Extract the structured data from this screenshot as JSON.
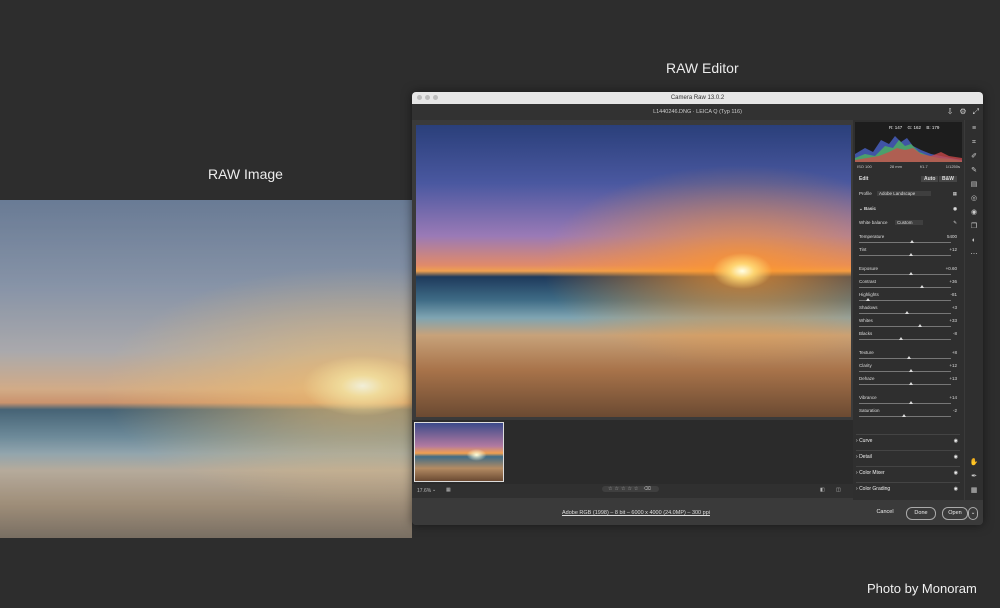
{
  "labels": {
    "raw_image": "RAW Image",
    "raw_editor": "RAW Editor",
    "credit": "Photo by Monoram"
  },
  "window": {
    "title": "Camera Raw 13.0.2",
    "file_info": "L1440246.DNG  ·  LEICA Q (Typ 116)",
    "zoom": "17.6%",
    "meta": "Adobe RGB (1998) – 8 bit – 6000 x 4000 (24.0MP) – 300 ppi",
    "buttons": {
      "cancel": "Cancel",
      "done": "Done",
      "open": "Open"
    }
  },
  "histogram": {
    "r": "R: 147",
    "g": "G: 162",
    "b": "B: 179"
  },
  "camera": {
    "iso": "ISO 100",
    "focal": "28 mm",
    "aperture": "f/1.7",
    "shutter": "1/1250s"
  },
  "panel": {
    "edit": "Edit",
    "auto": "Auto",
    "bw": "B&W",
    "profile_label": "Profile",
    "profile_value": "Adobe Landscape",
    "basic": "Basic",
    "wb_label": "White balance",
    "wb_value": "Custom",
    "sliders": [
      {
        "label": "Temperature",
        "value": "5400",
        "pos": 0.58
      },
      {
        "label": "Tint",
        "value": "+12",
        "pos": 0.56
      },
      {
        "label": "Exposure",
        "value": "+0.60",
        "pos": 0.56
      },
      {
        "label": "Contrast",
        "value": "+36",
        "pos": 0.68
      },
      {
        "label": "Highlights",
        "value": "-81",
        "pos": 0.1
      },
      {
        "label": "Shadows",
        "value": "+3",
        "pos": 0.52
      },
      {
        "label": "Whites",
        "value": "+33",
        "pos": 0.66
      },
      {
        "label": "Blacks",
        "value": "-8",
        "pos": 0.46
      },
      {
        "label": "Texture",
        "value": "+8",
        "pos": 0.54
      },
      {
        "label": "Clarity",
        "value": "+12",
        "pos": 0.56
      },
      {
        "label": "Dehaze",
        "value": "+13",
        "pos": 0.56
      },
      {
        "label": "Vibrance",
        "value": "+14",
        "pos": 0.57
      },
      {
        "label": "Saturation",
        "value": "-2",
        "pos": 0.49
      }
    ],
    "sections": [
      "Curve",
      "Detail",
      "Color Mixer",
      "Color Grading"
    ]
  }
}
